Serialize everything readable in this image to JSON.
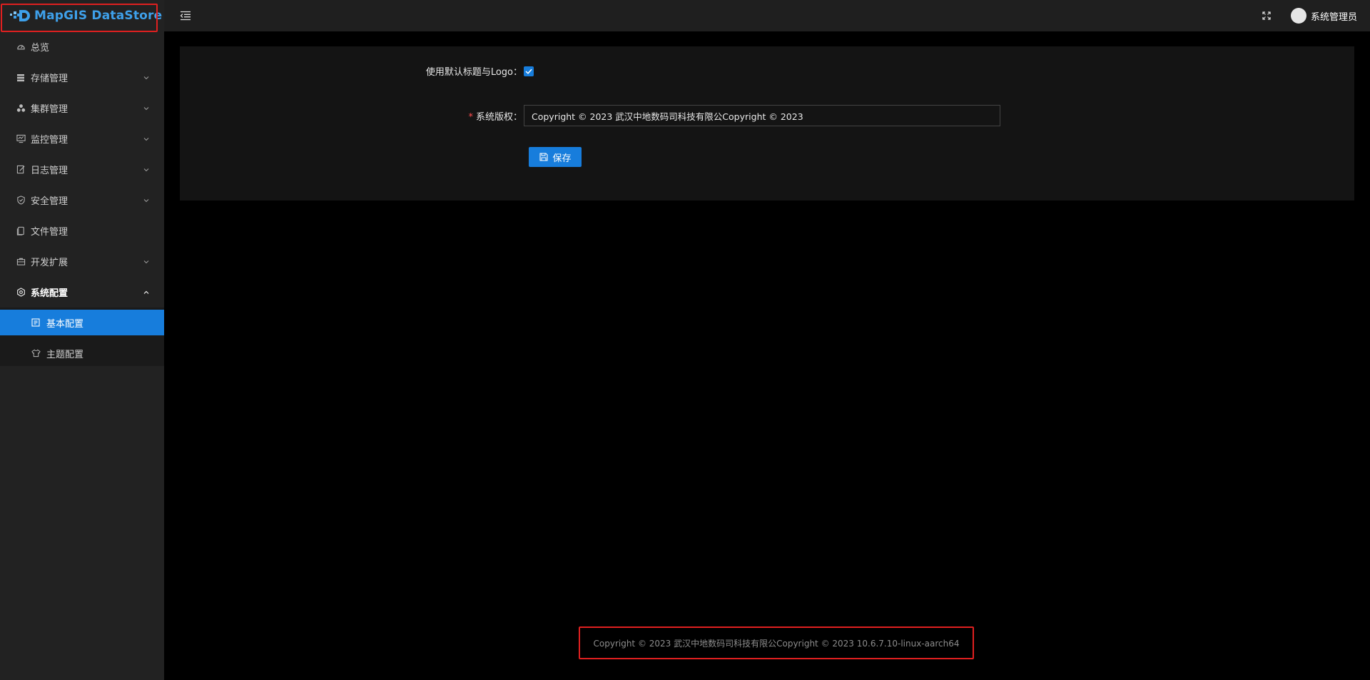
{
  "app": {
    "logo_text": "MapGIS DataStore"
  },
  "sidebar": {
    "items": [
      {
        "label": "总览",
        "icon": "dashboard-icon",
        "has_children": false
      },
      {
        "label": "存储管理",
        "icon": "database-icon",
        "has_children": true
      },
      {
        "label": "集群管理",
        "icon": "cluster-icon",
        "has_children": true
      },
      {
        "label": "监控管理",
        "icon": "monitor-icon",
        "has_children": true
      },
      {
        "label": "日志管理",
        "icon": "log-icon",
        "has_children": true
      },
      {
        "label": "安全管理",
        "icon": "shield-icon",
        "has_children": true
      },
      {
        "label": "文件管理",
        "icon": "file-icon",
        "has_children": false
      },
      {
        "label": "开发扩展",
        "icon": "toolbox-icon",
        "has_children": true
      },
      {
        "label": "系统配置",
        "icon": "settings-icon",
        "has_children": true,
        "open": true
      }
    ],
    "subitems": [
      {
        "label": "基本配置",
        "icon": "form-icon",
        "active": true
      },
      {
        "label": "主题配置",
        "icon": "skin-icon",
        "active": false
      }
    ]
  },
  "header": {
    "username": "系统管理员"
  },
  "form": {
    "default_logo_label": "使用默认标题与Logo：",
    "default_logo_checked": true,
    "copyright_label": "系统版权：",
    "copyright_value": "Copyright © 2023 武汉中地数码司科技有限公Copyright © 2023",
    "save_label": "保存"
  },
  "footer": {
    "text": "Copyright © 2023 武汉中地数码司科技有限公Copyright © 2023 10.6.7.10-linux-aarch64"
  },
  "colors": {
    "accent": "#177ddc",
    "highlight_border": "#e02020",
    "logo": "#3ea0ea"
  }
}
